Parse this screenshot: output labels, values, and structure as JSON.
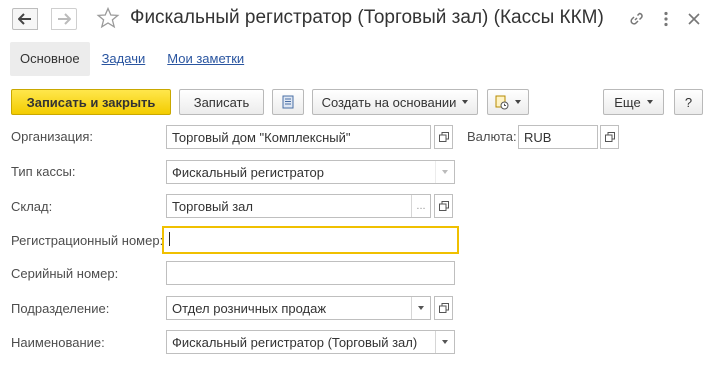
{
  "window": {
    "title": "Фискальный регистратор (Торговый зал) (Кассы ККМ)",
    "icons": [
      "arrow-left-icon",
      "arrow-right-icon",
      "star-icon",
      "link-icon",
      "more-vertical-icon",
      "close-icon"
    ]
  },
  "tabs": [
    {
      "label": "Основное",
      "active": true
    },
    {
      "label": "Задачи",
      "active": false
    },
    {
      "label": "Мои заметки",
      "active": false
    }
  ],
  "toolbar": {
    "save_close_label": "Записать и закрыть",
    "save_label": "Записать",
    "create_based_label": "Создать на основании",
    "more_label": "Еще",
    "help_label": "?",
    "accent_color": "#f7d21c"
  },
  "form": {
    "organization": {
      "label": "Организация:",
      "value": "Торговый дом \"Комплексный\""
    },
    "currency": {
      "label": "Валюта:",
      "value": "RUB"
    },
    "cash_type": {
      "label": "Тип кассы:",
      "value": "Фискальный регистратор"
    },
    "warehouse": {
      "label": "Склад:",
      "value": "Торговый зал",
      "select_label": "..."
    },
    "reg_number": {
      "label": "Регистрационный номер:",
      "value": ""
    },
    "serial_number": {
      "label": "Серийный номер:",
      "value": ""
    },
    "department": {
      "label": "Подразделение:",
      "value": "Отдел розничных продаж"
    },
    "name": {
      "label": "Наименование:",
      "value": "Фискальный регистратор (Торговый зал)"
    }
  }
}
